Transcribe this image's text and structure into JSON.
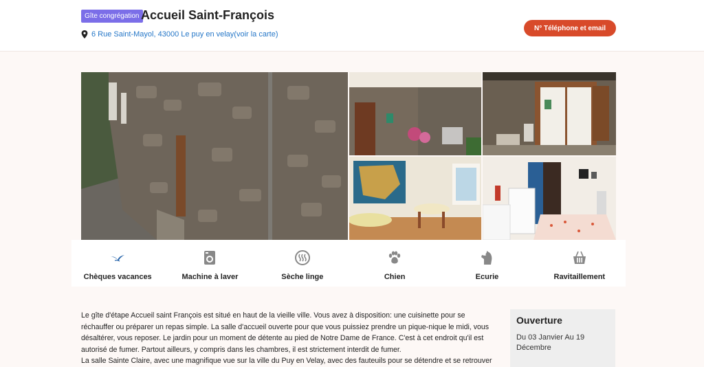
{
  "header": {
    "badge": "Gîte congrégation",
    "title": "Accueil Saint-François",
    "address": "6 Rue Saint-Mayol, 43000 Le puy en velay(voir la carte)",
    "contact_button": "N° Téléphone et email"
  },
  "amenities": [
    {
      "label": "Chèques vacances",
      "icon": "bird-icon"
    },
    {
      "label": "Machine à laver",
      "icon": "washing-machine-icon"
    },
    {
      "label": "Sèche linge",
      "icon": "dryer-icon"
    },
    {
      "label": "Chien",
      "icon": "paw-icon"
    },
    {
      "label": "Ecurie",
      "icon": "horse-icon"
    },
    {
      "label": "Ravitaillement",
      "icon": "basket-icon"
    }
  ],
  "description": {
    "p1": "Le gîte d'étape Accueil saint François est situé en haut de la vieille ville. Vous avez à disposition: une cuisinette pour se réchauffer ou préparer un repas simple. La salle d'accueil ouverte pour que vous puissiez prendre un pique-nique le midi, vous désaltérer, vous reposer. Le jardin pour un moment de détente au pied de Notre Dame de France. C'est à cet endroit qu'il est autorisé de fumer. Partout ailleurs, y compris dans les chambres, il est strictement interdit de fumer.",
    "p2": "La salle Sainte Claire, avec une magnifique vue sur la ville du Puy en Velay, avec des fauteuils pour se détendre et se retrouver"
  },
  "opening": {
    "title": "Ouverture",
    "text": "Du 03 Janvier Au 19 Décembre"
  },
  "colors": {
    "badge": "#7b6ee8",
    "contact_button": "#d84a2a",
    "link": "#2476c7",
    "accent_icon": "#1f5fa8"
  }
}
